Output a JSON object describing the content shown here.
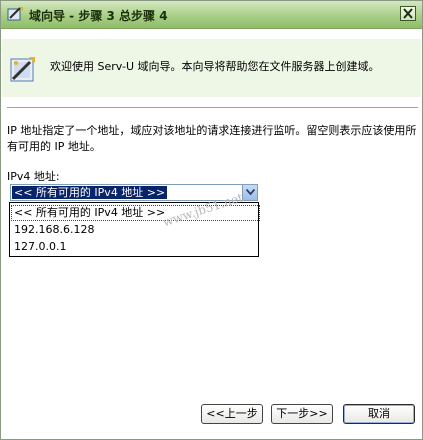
{
  "window": {
    "title": "域向导 - 步骤 3 总步骤 4"
  },
  "header": {
    "welcome_text": "欢迎使用 Serv-U 域向导。本向导将帮助您在文件服务器上创建域。"
  },
  "main": {
    "description": "IP 地址指定了一个地址，域应对该地址的请求连接进行监听。留空则表示应该使用所有可用的 IP 地址。",
    "ipv4_label": "IPv4 地址:",
    "ipv4_select": {
      "selected": "<< 所有可用的 IPv4 地址 >>",
      "options": [
        "<< 所有可用的 IPv4 地址 >>",
        "192.168.6.128",
        "127.0.0.1"
      ]
    }
  },
  "watermark": "www.jb51.net",
  "buttons": {
    "back": "<<上一步",
    "next": "下一步>>",
    "cancel": "取消"
  },
  "icons": {
    "title_icon": "wizard-icon",
    "close_icon": "close-icon",
    "header_icon": "wizard-icon",
    "dropdown_arrow": "chevron-down-icon"
  }
}
